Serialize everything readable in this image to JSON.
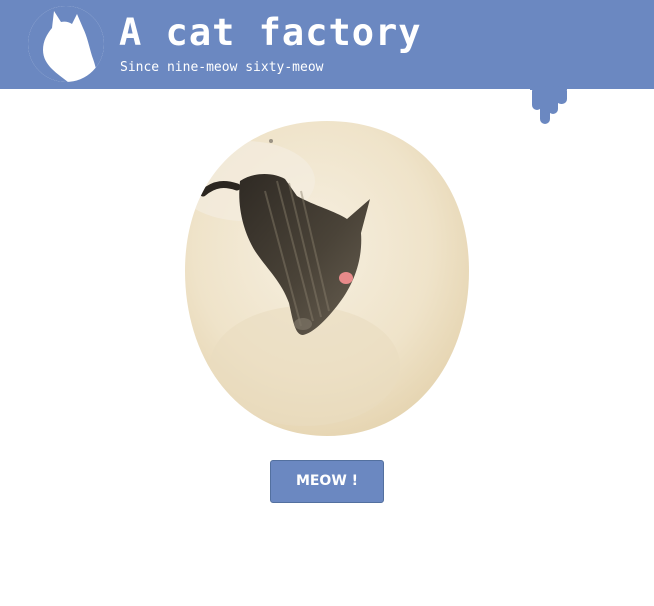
{
  "header": {
    "logo_icon": "cat-head-silhouette-icon",
    "title": "A cat factory",
    "subtitle": "Since nine-meow sixty-meow",
    "background_color": "#6b88c1",
    "text_color": "#ffffff"
  },
  "main": {
    "photo_subject": "black cat lying on a cream surface",
    "button_label": "MEOW !",
    "button_color": "#6b88c1"
  }
}
